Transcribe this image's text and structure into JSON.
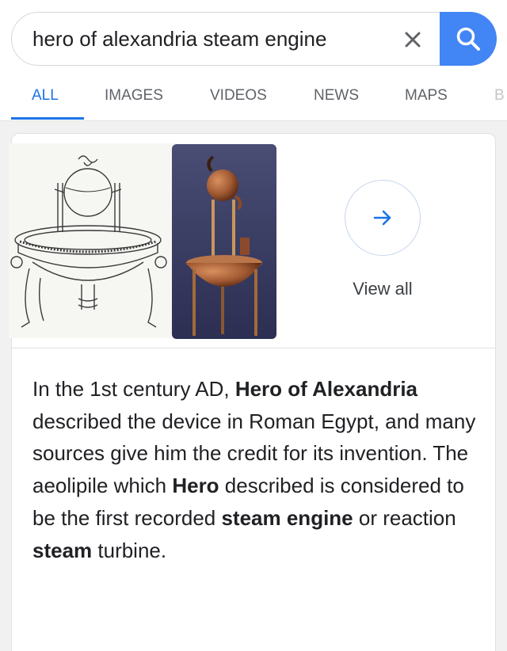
{
  "search": {
    "query": "hero of alexandria steam engine",
    "clear_icon": "close-icon",
    "submit_icon": "search-icon"
  },
  "tabs": [
    {
      "label": "ALL",
      "active": true
    },
    {
      "label": "IMAGES",
      "active": false
    },
    {
      "label": "VIDEOS",
      "active": false
    },
    {
      "label": "NEWS",
      "active": false
    },
    {
      "label": "MAPS",
      "active": false
    },
    {
      "label": "B",
      "active": false
    }
  ],
  "images": {
    "view_all_label": "View all",
    "view_all_icon": "arrow-right-icon"
  },
  "snippet": {
    "parts": [
      {
        "text": "In the 1st century AD, ",
        "bold": false
      },
      {
        "text": "Hero of Alexandria",
        "bold": true
      },
      {
        "text": " described the device in Roman Egypt, and many sources give him the credit for its invention. The aeolipile which ",
        "bold": false
      },
      {
        "text": "Hero",
        "bold": true
      },
      {
        "text": " described is considered to be the first recorded ",
        "bold": false
      },
      {
        "text": "steam engine",
        "bold": true
      },
      {
        "text": " or reaction ",
        "bold": false
      },
      {
        "text": "steam",
        "bold": true
      },
      {
        "text": " turbine.",
        "bold": false
      }
    ]
  },
  "colors": {
    "accent": "#1a73e8",
    "search_button": "#4285f4",
    "text": "#202124",
    "tab_inactive": "#5f6368"
  }
}
